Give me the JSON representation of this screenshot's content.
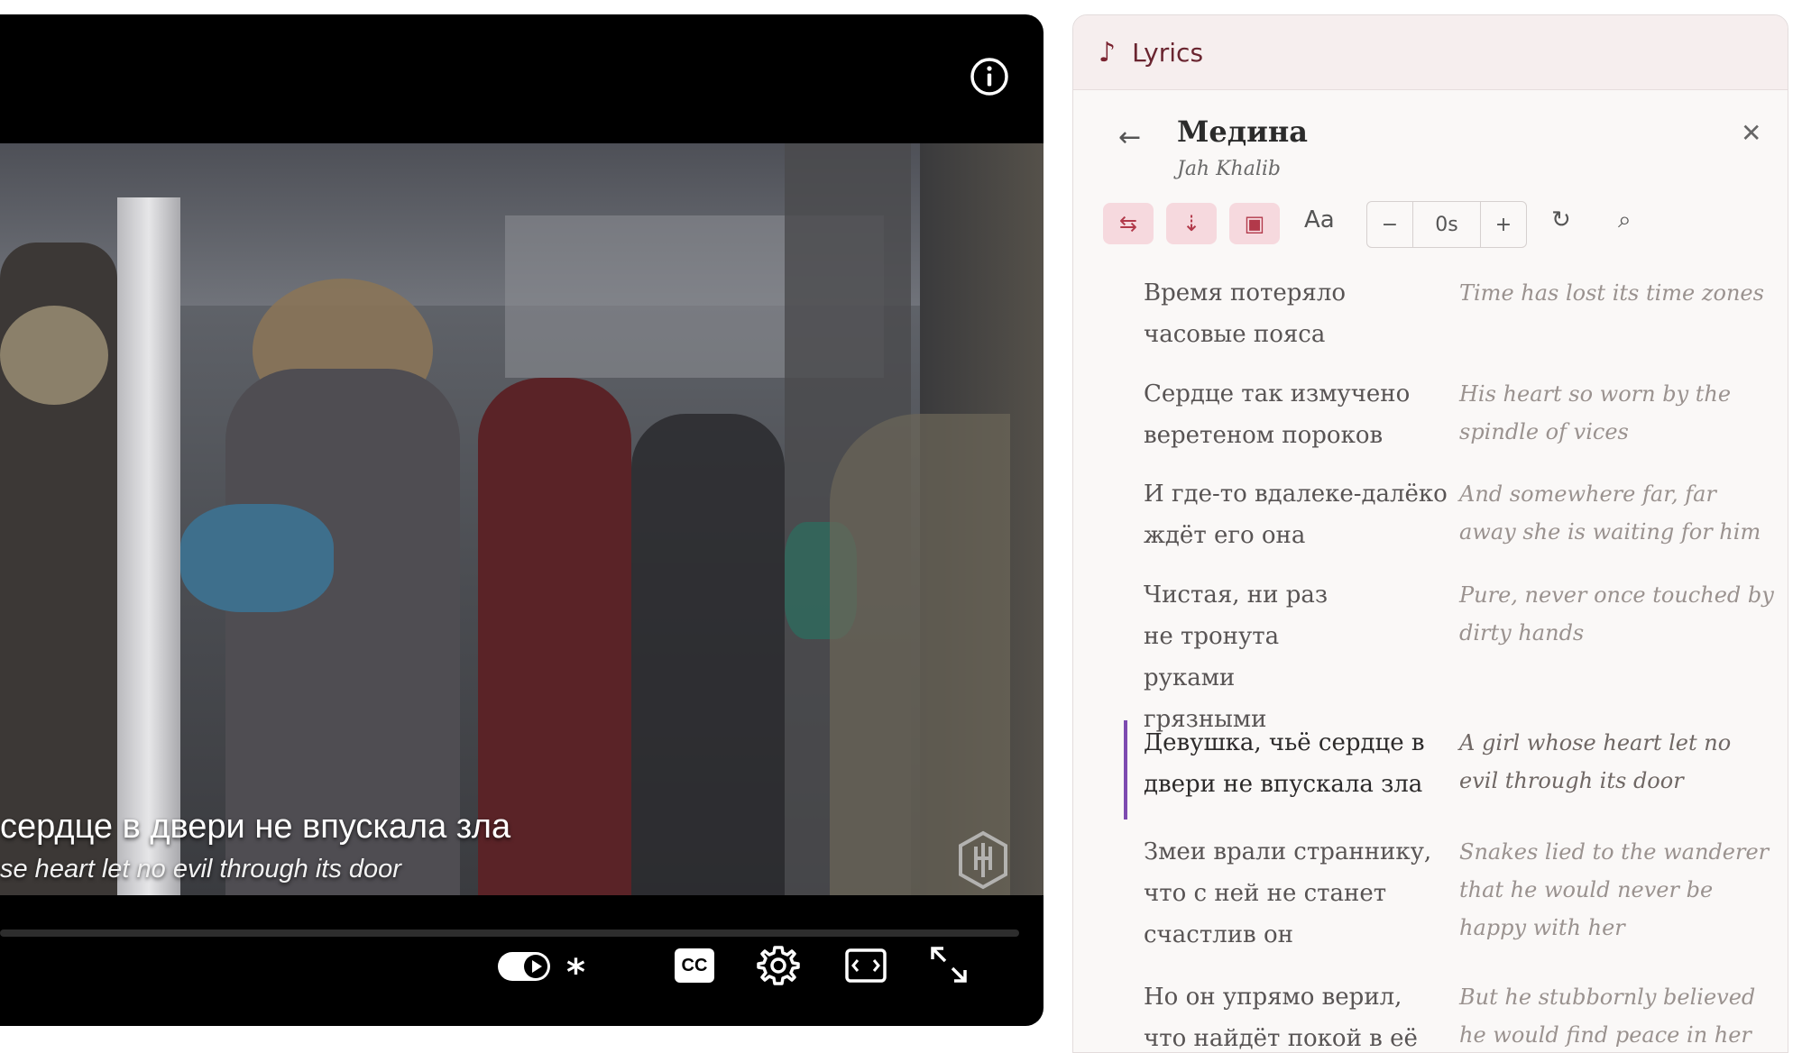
{
  "video": {
    "subtitle_original": "сердце в двери не впускала зла",
    "subtitle_translation": "se heart let no evil through its door",
    "controls": {
      "info_icon": "info-icon",
      "autoplay_icon": "autoplay-toggle-icon",
      "asterisk_icon": "asterisk-icon",
      "cc_label": "CC",
      "settings_icon": "gear-icon",
      "theater_icon": "theater-mode-icon",
      "fullscreen_icon": "fullscreen-icon"
    }
  },
  "panel": {
    "header_title": "Lyrics",
    "note_icon": "♪",
    "song_title": "Медина",
    "artist": "Jah Khalib",
    "back_icon": "←",
    "close_icon": "✕",
    "toolbar": {
      "swap_icon": "⇆",
      "scroll_icon": "⇣",
      "overlay_icon": "▣",
      "font_label": "Aa",
      "offset_minus": "−",
      "offset_value": "0s",
      "offset_plus": "+",
      "reset_icon": "↻",
      "search_icon": "⌕"
    },
    "accent_color": "#7d4bb0",
    "lines": [
      {
        "original": "Время потеряло часовые пояса",
        "translation": "Time has lost its time zones"
      },
      {
        "original": "Сердце так измучено веретеном пороков",
        "translation": "His heart so worn by the spindle of vices"
      },
      {
        "original": "И где-то вдалеке-далёко ждёт его она",
        "translation": "And somewhere far, far away she is waiting for him"
      },
      {
        "original": "Чистая, ни раз не тронута руками грязными",
        "translation": "Pure, never once touched by dirty hands"
      },
      {
        "original": "Девушка, чьё сердце в двери не впускала зла",
        "translation": "A girl whose heart let no evil through its door"
      },
      {
        "original": "Змеи врали страннику, что с ней не станет счастлив он",
        "translation": "Snakes lied to the wanderer that he would never be happy with her"
      },
      {
        "original": "Но он упрямо верил, что найдёт покой в её глазах",
        "translation": "But he stubbornly believed he would find peace in her"
      }
    ]
  }
}
